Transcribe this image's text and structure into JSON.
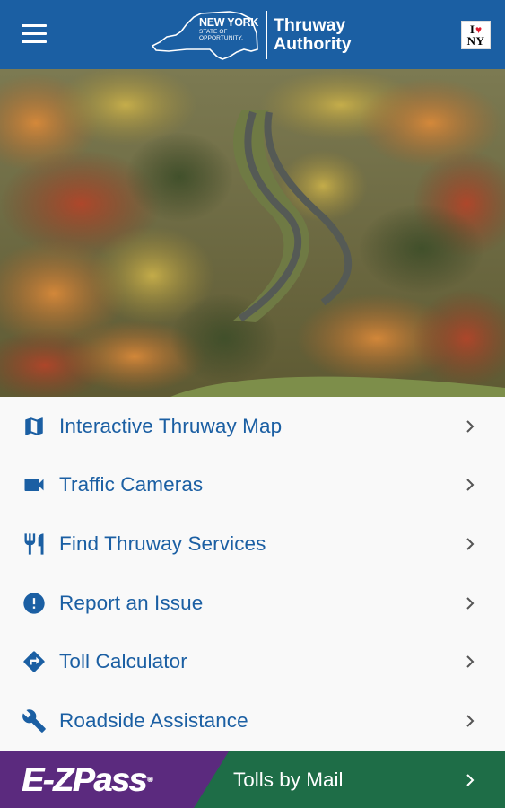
{
  "header": {
    "logo_big": "NEW YORK",
    "logo_small_1": "STATE OF",
    "logo_small_2": "OPPORTUNITY.",
    "title_line1": "Thruway",
    "title_line2": "Authority",
    "badge_top": "I",
    "badge_bottom": "NY"
  },
  "menu": {
    "items": [
      {
        "label": "Interactive Thruway Map",
        "icon": "map-icon"
      },
      {
        "label": "Traffic Cameras",
        "icon": "video-camera-icon"
      },
      {
        "label": "Find Thruway Services",
        "icon": "restaurant-icon"
      },
      {
        "label": "Report an Issue",
        "icon": "alert-icon"
      },
      {
        "label": "Toll Calculator",
        "icon": "directions-icon"
      },
      {
        "label": "Roadside Assistance",
        "icon": "wrench-icon"
      }
    ]
  },
  "bottom": {
    "ezpass_label": "E-ZPass",
    "ezpass_tm": "®",
    "tolls_label": "Tolls by Mail"
  },
  "colors": {
    "header_bg": "#1b5fa3",
    "accent_text": "#1b5fa3",
    "ezpass_purple": "#5b2a7e",
    "tolls_green": "#1e6d47",
    "list_bg": "#f9f9f9"
  }
}
